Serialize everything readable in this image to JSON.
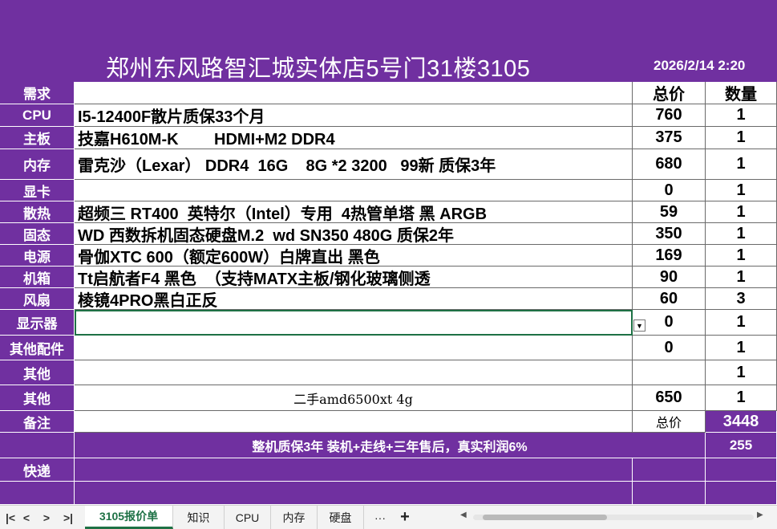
{
  "header": {
    "store_title": "郑州东风路智汇城实体店5号门31楼3105",
    "datetime": "2026/2/14 2:20"
  },
  "table": {
    "header": {
      "label": "需求",
      "price": "总价",
      "qty": "数量"
    },
    "rows": [
      {
        "label": "CPU",
        "desc": "I5-12400F散片质保33个月",
        "price": "760",
        "qty": "1"
      },
      {
        "label": "主板",
        "desc": "技嘉H610M-K        HDMI+M2 DDR4",
        "price": "375",
        "qty": "1"
      },
      {
        "label": "内存",
        "desc": "雷克沙（Lexar） DDR4  16G    8G *2 3200   99新 质保3年",
        "price": "680",
        "qty": "1"
      },
      {
        "label": "显卡",
        "desc": "",
        "price": "0",
        "qty": "1"
      },
      {
        "label": "散热",
        "desc": "超频三 RT400  英特尔（Intel）专用  4热管单塔 黑 ARGB",
        "price": "59",
        "qty": "1"
      },
      {
        "label": "固态",
        "desc": "WD 西数拆机固态硬盘M.2  wd SN350 480G 质保2年",
        "price": "350",
        "qty": "1"
      },
      {
        "label": "电源",
        "desc": "骨伽XTC 600（额定600W）白牌直出 黑色",
        "price": "169",
        "qty": "1"
      },
      {
        "label": "机箱",
        "desc": "Tt启航者F4 黑色  （支持MATX主板/钢化玻璃侧透",
        "price": "90",
        "qty": "1"
      },
      {
        "label": "风扇",
        "desc": "棱镜4PRO黑白正反",
        "price": "60",
        "qty": "3"
      },
      {
        "label": "显示器",
        "desc": "",
        "price": "0",
        "qty": "1"
      },
      {
        "label": "其他配件",
        "desc": "",
        "price": "0",
        "qty": "1"
      },
      {
        "label": "其他",
        "desc": "",
        "price": "",
        "qty": "1"
      },
      {
        "label": "其他",
        "desc": "二手amd6500xt 4g",
        "price": "650",
        "qty": "1"
      }
    ],
    "remark": {
      "label": "备注",
      "total_label": "总价",
      "total_value": "3448"
    },
    "warranty": {
      "text": "整机质保3年 装机+走线+三年售后，真实利润6%",
      "value": "255"
    },
    "express": {
      "label": "快递"
    }
  },
  "tabs": {
    "items": [
      "3105报价单",
      "知识",
      "CPU",
      "内存",
      "硬盘"
    ],
    "active_index": 0,
    "more": "···",
    "add": "+"
  },
  "nav": {
    "first": "|<",
    "prev": "<",
    "next": ">",
    "last": ">|"
  },
  "colors": {
    "accent": "#7030a0",
    "selection": "#1e7145"
  }
}
